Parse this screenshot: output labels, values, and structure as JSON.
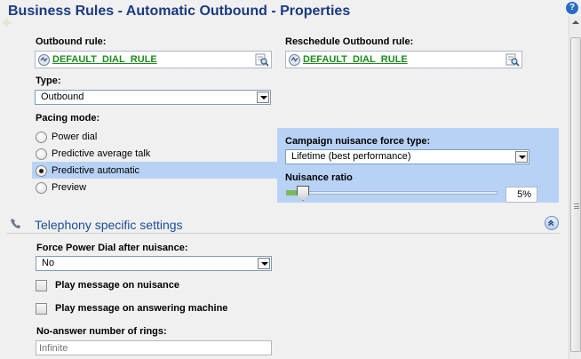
{
  "window": {
    "title": "Business Rules - Automatic Outbound - Properties",
    "help_label": "?"
  },
  "outbound_rule": {
    "label": "Outbound rule:",
    "value": "DEFAULT_DIAL_RULE"
  },
  "reschedule_rule": {
    "label": "Reschedule Outbound rule:",
    "value": "DEFAULT_DIAL_RULE"
  },
  "type": {
    "label": "Type:",
    "value": "Outbound"
  },
  "pacing": {
    "label": "Pacing mode:",
    "options": [
      {
        "label": "Power dial",
        "checked": false
      },
      {
        "label": "Predictive average talk",
        "checked": false
      },
      {
        "label": "Predictive automatic",
        "checked": true
      },
      {
        "label": "Preview",
        "checked": false
      }
    ]
  },
  "nuisance": {
    "force_type_label": "Campaign nuisance force type:",
    "force_type_value": "Lifetime (best performance)",
    "ratio_label": "Nuisance ratio",
    "ratio_value": "5%",
    "ratio_fraction": 0.05
  },
  "telephony": {
    "section_title": "Telephony specific settings",
    "force_power_label": "Force Power Dial after nuisance:",
    "force_power_value": "No",
    "play_nuisance_label": "Play message on nuisance",
    "play_answering_label": "Play message on answering machine",
    "no_answer_label": "No-answer number of rings:",
    "no_answer_placeholder": "Infinite"
  },
  "icons": {
    "help": "help-icon",
    "rule": "rule-icon",
    "browse": "browse-icon",
    "phone": "phone-icon",
    "collapse": "collapse-icon"
  },
  "colors": {
    "title": "#1b3a80",
    "rule_link": "#1f8a1f",
    "panel": "#b7d2f5",
    "section_title": "#1b4d9a"
  }
}
